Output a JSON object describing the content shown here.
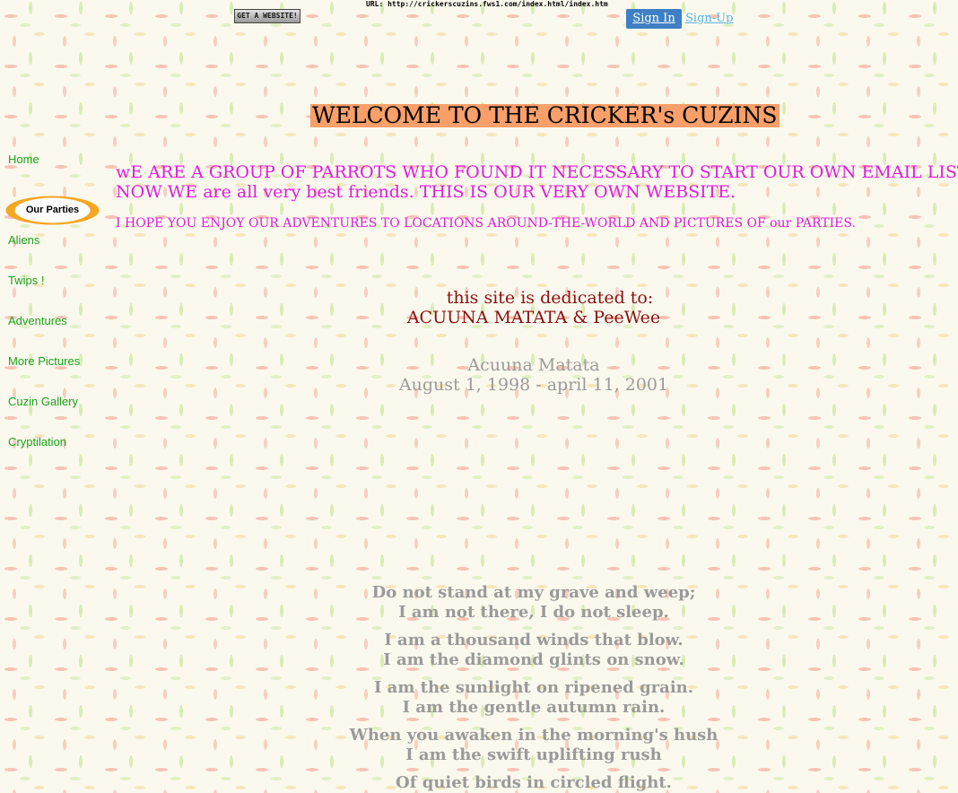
{
  "url_bar": "URL: http://crickerscuzins.fws1.com/index.html/index.htm",
  "top_bar": {
    "get_website": "GET A WEBSITE!",
    "sign_in": "Sign In",
    "sign_up": "Sign-Up",
    "sign_in_color": "#3f7fc3"
  },
  "page": {
    "title": "WELCOME TO THE CRICKER's CUZINS",
    "title_highlight": "#f99f6a",
    "intro_line_1": "wE ARE A GROUP OF PARROTS WHO FOUND IT NECESSARY TO START OUR OWN EMAIL LIST.",
    "intro_line_2": "NOW WE are all very best friends. THIS IS OUR VERY OWN WEBSITE.",
    "intro_line_3": "I HOPE YOU ENJOY OUR ADVENTURES TO LOCATIONS AROUND-THE-WORLD AND PICTURES OF our PARTIES.",
    "dedication_1": "this site is dedicated to:",
    "dedication_2": "ACUUNA MATATA & PeeWee",
    "memorial_name": "Acuuna Matata",
    "memorial_dates": "August 1, 1998 - april 11, 2001"
  },
  "nav": {
    "items": [
      {
        "label": "Home",
        "active": false
      },
      {
        "label": "Our Parties",
        "active": true
      },
      {
        "label": "Aliens",
        "active": false
      },
      {
        "label": "Twips !",
        "active": false
      },
      {
        "label": "Adventures",
        "active": false
      },
      {
        "label": "More Pictures",
        "active": false
      },
      {
        "label": "Cuzin Gallery",
        "active": false
      },
      {
        "label": "Cryptilation",
        "active": false
      }
    ],
    "active_color": "#f5a623"
  },
  "poem": [
    "Do not stand at my grave and weep;",
    "I am not there, I do not sleep.",
    "I am a thousand winds that blow.",
    "I am the diamond glints on snow.",
    "I am the sunlight on ripened grain.",
    "I am the gentle autumn rain.",
    "When you awaken in the morning's hush",
    "I am the swift uplifting rush",
    "Of quiet birds in circled flight."
  ]
}
